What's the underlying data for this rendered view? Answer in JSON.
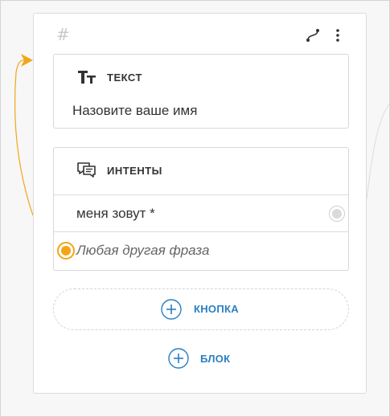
{
  "card": {
    "hash_symbol": "#",
    "header_icons": [
      "route-icon",
      "more-vertical-icon"
    ]
  },
  "text_block": {
    "title": "ТЕКСТ",
    "icon": "text-type-icon",
    "content": "Назовите ваше имя"
  },
  "intents_block": {
    "title": "ИНТЕНТЫ",
    "icon": "chat-bubbles-icon",
    "rows": [
      {
        "label": "меня зовут *",
        "connector": "grey"
      },
      {
        "label": "Любая другая фраза",
        "connector": "orange"
      }
    ]
  },
  "actions": {
    "button_label": "КНОПКА",
    "block_label": "БЛОК"
  },
  "colors": {
    "accent_blue": "#2a7fc2",
    "accent_orange": "#f3a517",
    "connector_grey": "#dadada"
  }
}
